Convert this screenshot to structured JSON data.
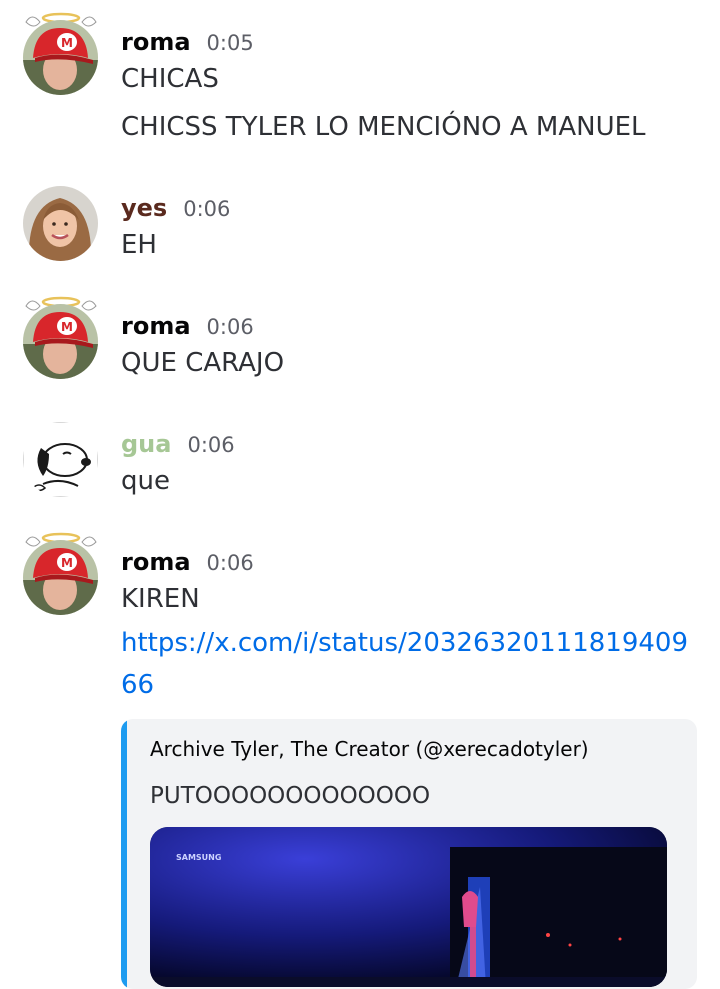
{
  "messages": [
    {
      "author": "roma",
      "time": "0:05",
      "lines": [
        "CHICAS",
        "CHICSS TYLER LO MENCIÓNO A MANUEL"
      ]
    },
    {
      "author": "yes",
      "time": "0:06",
      "lines": [
        "EH"
      ]
    },
    {
      "author": "roma",
      "time": "0:06",
      "lines": [
        "QUE CARAJO"
      ]
    },
    {
      "author": "gua",
      "time": "0:06",
      "lines": [
        "que"
      ]
    },
    {
      "author": "roma",
      "time": "0:06",
      "lines": [
        "KIREN"
      ],
      "link": "https://x.com/i/status/2032632011181940966"
    }
  ],
  "embed": {
    "author": "Archive Tyler, The Creator (@xerecadotyler)",
    "description": "PUTOOOOOOOOOOOOO",
    "image_text": "SAMSUNG"
  },
  "colors": {
    "roma": "#060607",
    "yes": "#5a2a1e",
    "gua": "#a6c795",
    "link": "#006ce7",
    "embed_accent": "#1d9bf0"
  },
  "icons": [
    "halo-icon",
    "mario-avatar",
    "girl-avatar",
    "snoopy-avatar"
  ]
}
